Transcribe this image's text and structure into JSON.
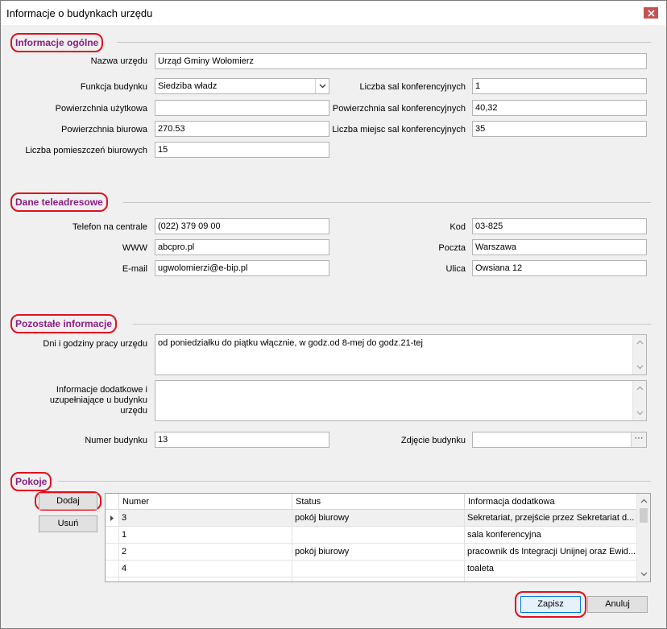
{
  "window": {
    "title": "Informacje o budynkach urzędu"
  },
  "sections": {
    "general": "Informacje ogólne",
    "contact": "Dane teleadresowe",
    "other": "Pozostałe informacje",
    "rooms": "Pokoje"
  },
  "general": {
    "office_name_label": "Nazwa urzędu",
    "office_name": "Urząd Gminy Wołomierz",
    "building_function_label": "Funkcja budynku",
    "building_function": "Siedziba władz",
    "usable_area_label": "Powierzchnia użytkowa",
    "usable_area": "",
    "office_area_label": "Powierzchnia biurowa",
    "office_area": "270.53",
    "office_rooms_count_label": "Liczba pomieszczeń biurowych",
    "office_rooms_count": "15",
    "conf_rooms_count_label": "Liczba sal konferencyjnych",
    "conf_rooms_count": "1",
    "conf_rooms_area_label": "Powierzchnia sal konferencyjnych",
    "conf_rooms_area": "40,32",
    "conf_seats_label": "Liczba miejsc sal konferencyjnych",
    "conf_seats": "35"
  },
  "contact": {
    "phone_label": "Telefon na centrale",
    "phone": "(022) 379 09 00",
    "www_label": "WWW",
    "www": "abcpro.pl",
    "email_label": "E-mail",
    "email": "ugwolomierzi@e-bip.pl",
    "postal_code_label": "Kod",
    "postal_code": "03-825",
    "post_office_label": "Poczta",
    "post_office": "Warszawa",
    "street_label": "Ulica",
    "street": "Owsiana 12"
  },
  "other": {
    "working_hours_label": "Dni i godziny pracy urzędu",
    "working_hours": "od poniedziałku do piątku włącznie, w godz.od 8-mej do godz.21-tej",
    "additional_info_label_1": "Informacje dodatkowe i",
    "additional_info_label_2": "uzupełniające u budynku",
    "additional_info_label_3": "urzędu",
    "additional_info": "",
    "building_number_label": "Numer budynku",
    "building_number": "13",
    "building_photo_label": "Zdjęcie budynku",
    "building_photo": "",
    "ellipsis": "···"
  },
  "rooms": {
    "add_button": "Dodaj",
    "remove_button": "Usuń",
    "columns": [
      "Numer",
      "Status",
      "Informacja dodatkowa"
    ],
    "rows": [
      {
        "number": "3",
        "status": "pokój biurowy",
        "info": "Sekretariat, przejście przez Sekretariat d..."
      },
      {
        "number": "1",
        "status": "",
        "info": "sala konferencyjna"
      },
      {
        "number": "2",
        "status": "pokój biurowy",
        "info": "pracownik ds Integracji Unijnej oraz Ewid..."
      },
      {
        "number": "4",
        "status": "",
        "info": "toaleta"
      }
    ]
  },
  "footer": {
    "save_button": "Zapisz",
    "cancel_button": "Anuluj"
  },
  "colors": {
    "section_text": "#8a1d84",
    "highlight_ring": "#e0101e",
    "close_button": "#c75050"
  }
}
